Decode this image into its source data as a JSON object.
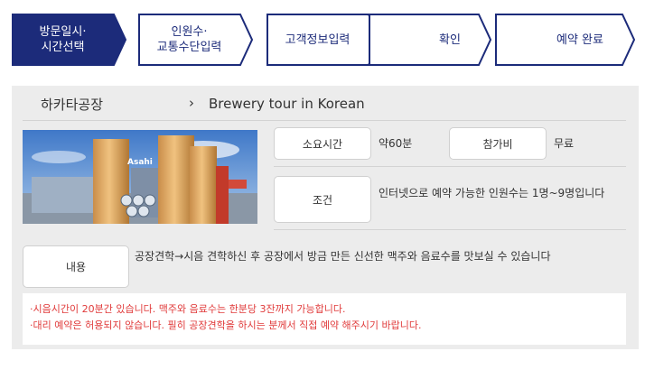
{
  "steps": [
    {
      "label": "방문일시·\n시간선택",
      "active": true
    },
    {
      "label": "인원수·\n교통수단입력",
      "active": false
    },
    {
      "label": "고객정보입력",
      "active": false
    },
    {
      "label": "확인",
      "active": false
    },
    {
      "label": "예약 완료",
      "active": false
    }
  ],
  "header": {
    "factory": "하카타공장",
    "chevron": "›",
    "tour": "Brewery tour in Korean"
  },
  "details": {
    "duration_label": "소요시간",
    "duration_value": "약60분",
    "fee_label": "참가비",
    "fee_value": "무료",
    "condition_label": "조건",
    "condition_value": "인터넷으로 예약 가능한 인원수는 1명~9명입니다",
    "content_label": "내용",
    "content_value": "공장견학→시음 견학하신 후 공장에서 방금 만든 신선한 맥주와 음료수를 맛보실 수 있습니다"
  },
  "notes": [
    "·시음시간이 20분간 있습니다. 맥주와 음료수는 한분당 3잔까지 가능합니다.",
    "·대리 예약은 허용되지 않습니다. 필히 공장견학을 하시는 분께서 직접 예약 해주시기 바랍니다."
  ],
  "photo": {
    "sign_text": "Asahi"
  },
  "colors": {
    "accent": "#1c2b7a",
    "note_red": "#e03a3a"
  }
}
